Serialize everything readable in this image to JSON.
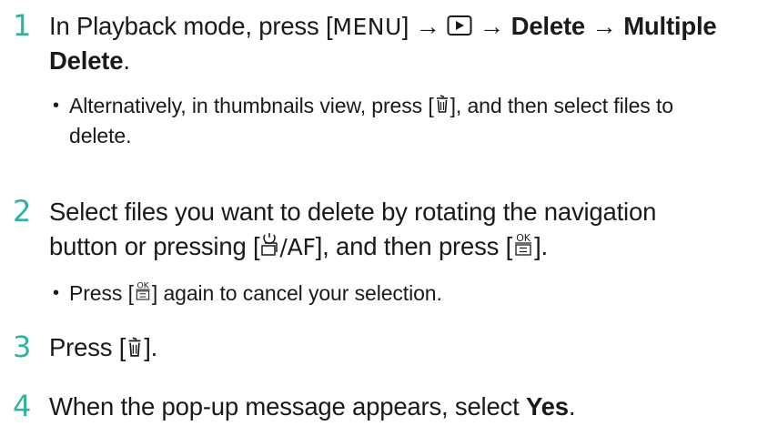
{
  "steps": [
    {
      "number": "1",
      "prefix": "In Playback mode, press [",
      "menu_label": "MENU",
      "after_menu": "] →",
      "arrow_1": "→",
      "delete": "Delete",
      "arrow_2": "→",
      "multiple": "Multiple",
      "delete_2": "Delete",
      "period": ".",
      "note_prefix": "Alternatively, in thumbnails view, press [",
      "note_suffix": "], and then select files to",
      "note_line2": "delete."
    },
    {
      "number": "2",
      "line1": "Select files you want to delete by rotating the navigation",
      "line2_prefix": "button or pressing [",
      "af_label": "/AF",
      "line2_mid": "], and then press [",
      "line2_suffix": "].",
      "note_prefix": "Press [",
      "note_suffix": "] again to cancel your selection."
    },
    {
      "number": "3",
      "prefix": "Press [",
      "suffix": "]."
    },
    {
      "number": "4",
      "prefix": "When the pop-up message appears, select ",
      "yes": "Yes",
      "period": "."
    }
  ],
  "icons": {
    "play": "playback-icon",
    "trash": "trash-icon",
    "timer": "timer-drive-icon",
    "ok": "ok-fn-icon"
  },
  "colors": {
    "accent": "#2fb3a0",
    "text": "#1a1a1a"
  }
}
